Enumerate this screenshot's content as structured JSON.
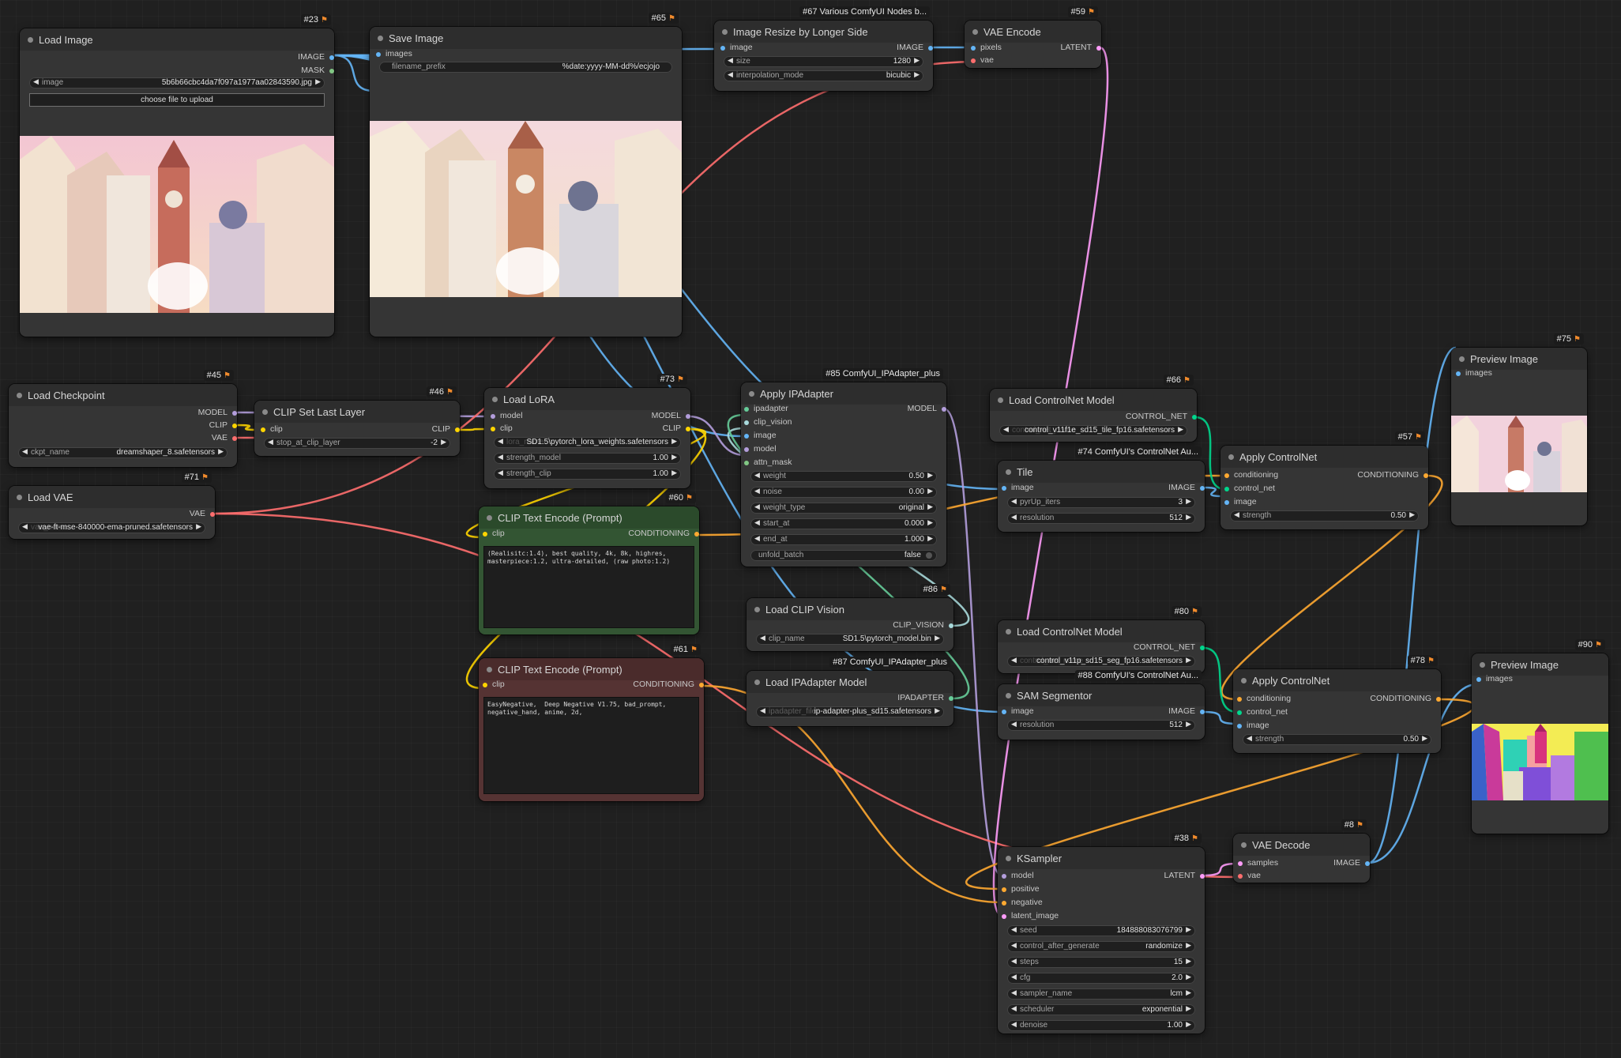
{
  "colors": {
    "IMAGE": "#64b5f6",
    "MASK": "#81c784",
    "MODEL": "#b39ddb",
    "CLIP": "#ffd500",
    "VAE": "#ff6e6e",
    "LATENT": "#ff9cf9",
    "CONDITIONING": "#ffa931",
    "CONTROL_NET": "#00d78d",
    "CLIP_VISION": "#a8dadc",
    "IPADAPTER": "#66cc99"
  },
  "nodes": {
    "n23": {
      "badge": "#23",
      "title": "Load Image",
      "outputs": [
        "IMAGE",
        "MASK"
      ],
      "w_image_label": "image",
      "w_image_value": "5b6b66cbc4da7f097a1977aa02843590.jpg",
      "upload_label": "choose file to upload"
    },
    "n65": {
      "badge": "#65",
      "title": "Save Image",
      "inputs": [
        "images"
      ],
      "w_prefix_label": "filename_prefix",
      "w_prefix_value": "%date:yyyy-MM-dd%/ecjojo"
    },
    "n67": {
      "badge": "#67 Various ComfyUI Nodes b...",
      "title": "Image Resize by Longer Side",
      "inputs": [
        "image"
      ],
      "outputs": [
        "IMAGE"
      ],
      "w_size_label": "size",
      "w_size_value": "1280",
      "w_interp_label": "interpolation_mode",
      "w_interp_value": "bicubic"
    },
    "n59": {
      "badge": "#59",
      "title": "VAE Encode",
      "inputs": [
        "pixels",
        "vae"
      ],
      "outputs": [
        "LATENT"
      ]
    },
    "n45": {
      "badge": "#45",
      "title": "Load Checkpoint",
      "outputs": [
        "MODEL",
        "CLIP",
        "VAE"
      ],
      "w_ckpt_label": "ckpt_name",
      "w_ckpt_value": "dreamshaper_8.safetensors"
    },
    "n46": {
      "badge": "#46",
      "title": "CLIP Set Last Layer",
      "inputs": [
        "clip"
      ],
      "outputs": [
        "CLIP"
      ],
      "w_stop_label": "stop_at_clip_layer",
      "w_stop_value": "-2"
    },
    "n73": {
      "badge": "#73",
      "title": "Load LoRA",
      "inputs": [
        "model",
        "clip"
      ],
      "outputs": [
        "MODEL",
        "CLIP"
      ],
      "w_lora_label": "lora_name",
      "w_lora_value": "SD1.5\\pytorch_lora_weights.safetensors",
      "w_sm_label": "strength_model",
      "w_sm_value": "1.00",
      "w_sc_label": "strength_clip",
      "w_sc_value": "1.00"
    },
    "n85": {
      "badge": "#85 ComfyUI_IPAdapter_plus",
      "title": "Apply IPAdapter",
      "inputs": [
        "ipadapter",
        "clip_vision",
        "image",
        "model",
        "attn_mask"
      ],
      "outputs": [
        "MODEL"
      ],
      "widgets": [
        {
          "label": "weight",
          "value": "0.50"
        },
        {
          "label": "noise",
          "value": "0.00"
        },
        {
          "label": "weight_type",
          "value": "original"
        },
        {
          "label": "start_at",
          "value": "0.000"
        },
        {
          "label": "end_at",
          "value": "1.000"
        }
      ],
      "w_unfold_label": "unfold_batch",
      "w_unfold_value": "false"
    },
    "n66": {
      "badge": "#66",
      "title": "Load ControlNet Model",
      "outputs": [
        "CONTROL_NET"
      ],
      "w_cn_label": "control_net_name",
      "w_cn_value": "control_v11f1e_sd15_tile_fp16.safetensors"
    },
    "n74": {
      "badge": "#74 ComfyUI's ControlNet Au...",
      "title": "Tile",
      "inputs": [
        "image"
      ],
      "outputs": [
        "IMAGE"
      ],
      "w_pyr_label": "pyrUp_iters",
      "w_pyr_value": "3",
      "w_res_label": "resolution",
      "w_res_value": "512"
    },
    "n57": {
      "badge": "#57",
      "title": "Apply ControlNet",
      "inputs": [
        "conditioning",
        "control_net",
        "image"
      ],
      "outputs": [
        "CONDITIONING"
      ],
      "w_str_label": "strength",
      "w_str_value": "0.50"
    },
    "n75": {
      "badge": "#75",
      "title": "Preview Image",
      "inputs": [
        "images"
      ]
    },
    "n71": {
      "badge": "#71",
      "title": "Load VAE",
      "outputs": [
        "VAE"
      ],
      "w_vae_label": "vae_name",
      "w_vae_value": "vae-ft-mse-840000-ema-pruned.safetensors"
    },
    "n60": {
      "badge": "#60",
      "title": "CLIP Text Encode (Prompt)",
      "inputs": [
        "clip"
      ],
      "outputs": [
        "CONDITIONING"
      ],
      "text": "(Realisitc:1.4), best quality, 4k, 8k, highres, masterpiece:1.2, ultra-detailed, (raw photo:1.2)"
    },
    "n61": {
      "badge": "#61",
      "title": "CLIP Text Encode (Prompt)",
      "inputs": [
        "clip"
      ],
      "outputs": [
        "CONDITIONING"
      ],
      "text": "EasyNegative,  Deep Negative V1.75, bad_prompt, negative_hand, anime, 2d,"
    },
    "n86": {
      "badge": "#86",
      "title": "Load CLIP Vision",
      "outputs": [
        "CLIP_VISION"
      ],
      "w_clip_label": "clip_name",
      "w_clip_value": "SD1.5\\pytorch_model.bin"
    },
    "n87": {
      "badge": "#87 ComfyUI_IPAdapter_plus",
      "title": "Load IPAdapter Model",
      "outputs": [
        "IPADAPTER"
      ],
      "w_ip_label": "ipadapter_file",
      "w_ip_value": "ip-adapter-plus_sd15.safetensors"
    },
    "n80": {
      "badge": "#80",
      "title": "Load ControlNet Model",
      "outputs": [
        "CONTROL_NET"
      ],
      "w_cn_label": "control_net_name",
      "w_cn_value": "control_v11p_sd15_seg_fp16.safetensors"
    },
    "n88": {
      "badge": "#88 ComfyUI's ControlNet Au...",
      "title": "SAM Segmentor",
      "inputs": [
        "image"
      ],
      "outputs": [
        "IMAGE"
      ],
      "w_res_label": "resolution",
      "w_res_value": "512"
    },
    "n78": {
      "badge": "#78",
      "title": "Apply ControlNet",
      "inputs": [
        "conditioning",
        "control_net",
        "image"
      ],
      "outputs": [
        "CONDITIONING"
      ],
      "w_str_label": "strength",
      "w_str_value": "0.50"
    },
    "n90": {
      "badge": "#90",
      "title": "Preview Image",
      "inputs": [
        "images"
      ]
    },
    "n38": {
      "badge": "#38",
      "title": "KSampler",
      "inputs": [
        "model",
        "positive",
        "negative",
        "latent_image"
      ],
      "outputs": [
        "LATENT"
      ],
      "widgets": [
        {
          "label": "seed",
          "value": "184888083076799"
        },
        {
          "label": "control_after_generate",
          "value": "randomize"
        },
        {
          "label": "steps",
          "value": "15"
        },
        {
          "label": "cfg",
          "value": "2.0"
        },
        {
          "label": "sampler_name",
          "value": "lcm"
        },
        {
          "label": "scheduler",
          "value": "exponential"
        },
        {
          "label": "denoise",
          "value": "1.00"
        }
      ]
    },
    "n8": {
      "badge": "#8",
      "title": "VAE Decode",
      "inputs": [
        "samples",
        "vae"
      ],
      "outputs": [
        "IMAGE"
      ]
    }
  }
}
